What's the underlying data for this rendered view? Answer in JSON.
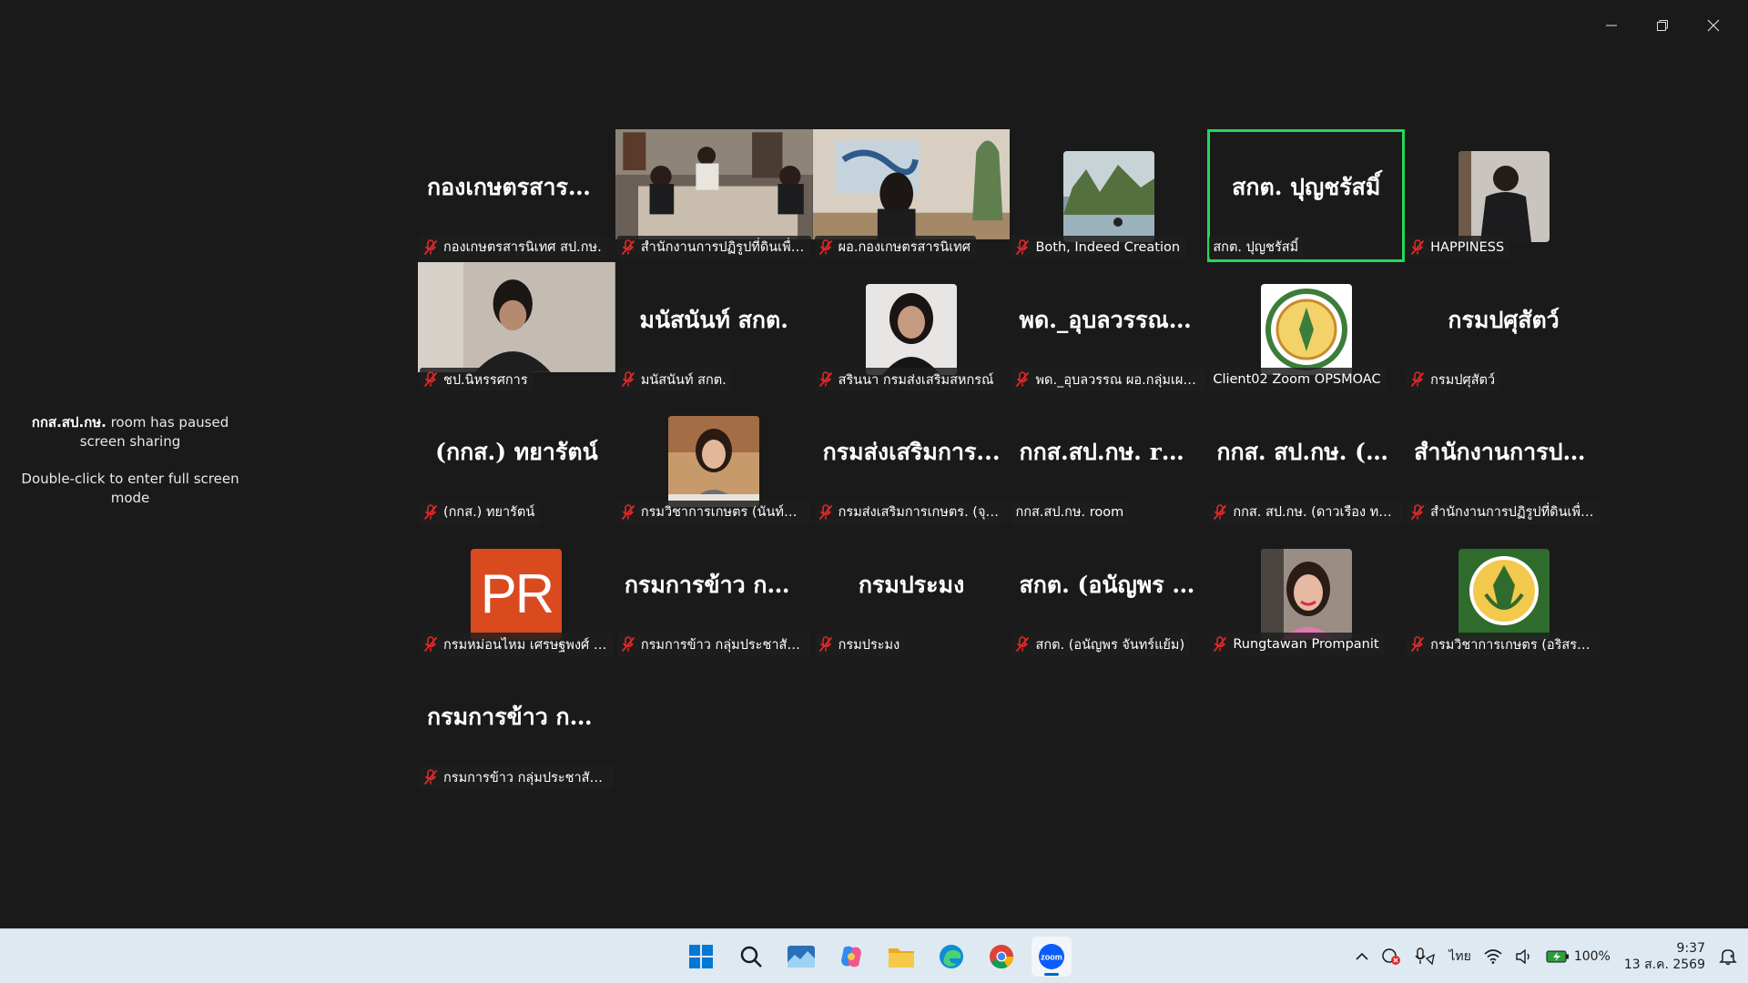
{
  "notice": {
    "room_bold": "กกส.สป.กษ.",
    "room_rest": " room  has  paused screen sharing",
    "hint": "Double-click to enter full screen mode"
  },
  "tiles": [
    {
      "big": "กองเกษตรสารนิ...",
      "label": "กองเกษตรสารนิเทศ สป.กษ.",
      "muted": true
    },
    {
      "big": "",
      "label": "สำนักงานการปฏิรูปที่ดินเพื่อเกษตรก...",
      "muted": true
    },
    {
      "big": "",
      "label": "ผอ.กองเกษตรสารนิเทศ",
      "muted": true
    },
    {
      "big": "",
      "label": "Both, Indeed Creation",
      "muted": true
    },
    {
      "big": "สกต. ปุญชรัสมิ์",
      "label": "สกต. ปุญชรัสมิ์",
      "muted": false
    },
    {
      "big": "",
      "label": "HAPPINESS",
      "muted": true
    },
    {
      "big": "",
      "label": "ชป.นิหรรศการ",
      "muted": true
    },
    {
      "big": "มนัสนันท์ สกต.",
      "label": "มนัสนันท์ สกต.",
      "muted": true
    },
    {
      "big": "",
      "label": "สรินนา กรมส่งเสริมสหกรณ์",
      "muted": true
    },
    {
      "big": "พด._อุบลวรรณ ผ...",
      "label": "พด._อุบลวรรณ ผอ.กลุ่มเผยแพร่ฯ",
      "muted": true
    },
    {
      "big": "",
      "label": "Client02 Zoom OPSMOAC",
      "muted": false
    },
    {
      "big": "กรมปศุสัตว์",
      "label": "กรมปศุสัตว์",
      "muted": true
    },
    {
      "big": "(กกส.) ทยารัตน์",
      "label": "(กกส.) ทยารัตน์",
      "muted": true
    },
    {
      "big": "",
      "label": "กรมวิชาการเกษตร (นันท์นภัส พูลสวั...",
      "muted": true
    },
    {
      "big": "กรมส่งเสริมการ...",
      "label": "กรมส่งเสริมการเกษตร. (จุฑามาศ กรี...",
      "muted": true
    },
    {
      "big": "กกส.สป.กษ. room",
      "label": "กกส.สป.กษ. room",
      "muted": false
    },
    {
      "big": "กกส. สป.กษ. (ดา...",
      "label": "กกส. สป.กษ. (ดาวเรือง ทองเขียว)",
      "muted": true
    },
    {
      "big": "สำนักงานการปฏิรู...",
      "label": "สำนักงานการปฏิรูปที่ดินเพื่อเกษตรก...",
      "muted": true
    },
    {
      "big": "",
      "label": "กรมหม่อนไหม เศรษฐพงศ์ ทองสุข น...",
      "muted": true
    },
    {
      "big": "กรมการข้าว กลุ่ม...",
      "label": "กรมการข้าว กลุ่มประชาสัมพันธ์ (กวิ...",
      "muted": true
    },
    {
      "big": "กรมประมง",
      "label": "กรมประมง",
      "muted": true
    },
    {
      "big": "สกต. (อนัญพร จั...",
      "label": "สกต. (อนัญพร จันทร์แย้ม)",
      "muted": true
    },
    {
      "big": "",
      "label": "Rungtawan Prompanit",
      "muted": true
    },
    {
      "big": "",
      "label": "กรมวิชาการเกษตร (อริสรา ชูสุวรรณ)",
      "muted": true
    },
    {
      "big": "กรมการข้าว กลุ่ม...",
      "label": "กรมการข้าว กลุ่มประชาสัมพันธ์ (อุมา)",
      "muted": true
    }
  ],
  "avatar_text": {
    "pr": "PR"
  },
  "tray": {
    "lang": "ไทย",
    "battery": "100%",
    "time": "9:37",
    "date": "13 ส.ค. 2569"
  },
  "colors": {
    "speaking": "#23d959",
    "mute": "#e02828",
    "zoom": "#0b5cff"
  }
}
